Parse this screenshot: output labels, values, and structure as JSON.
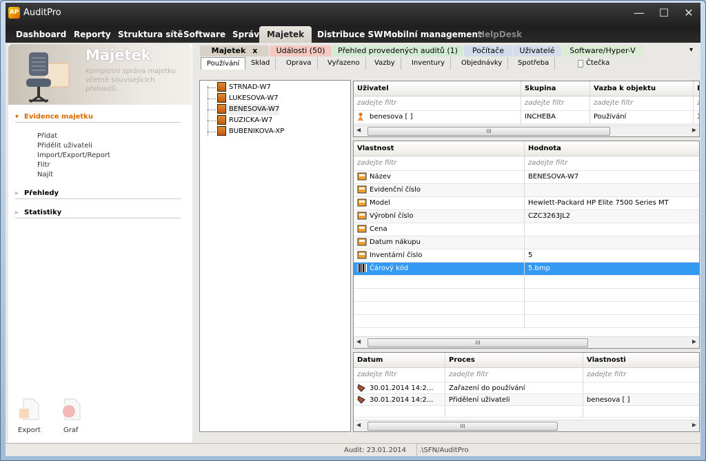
{
  "app": {
    "title": "AuditPro",
    "logo": "AP"
  },
  "window_controls": {
    "minimize": "—",
    "maximize": "☐",
    "close": "✕"
  },
  "main_tabs": [
    {
      "label": "Dashboard"
    },
    {
      "label": "Reporty"
    },
    {
      "label": "Struktura sítě"
    },
    {
      "label": "Software"
    },
    {
      "label": "Správa"
    },
    {
      "label": "Majetek",
      "active": true
    },
    {
      "label": "Distribuce SW"
    },
    {
      "label": "Mobilní management"
    },
    {
      "label": "HelpDesk",
      "disabled": true
    }
  ],
  "sidebar": {
    "title": "Majetek",
    "description": "Kompletní správa majetku včetně souvisejících přehledů.",
    "sections": [
      {
        "label": "Evidence majetku",
        "open": true,
        "items": [
          "Přidat",
          "Přidělit uživateli",
          "Import/Export/Report",
          "Filtr",
          "Najít"
        ]
      },
      {
        "label": "Přehledy"
      },
      {
        "label": "Statistiky"
      }
    ],
    "buttons": [
      {
        "label": "Export",
        "icon": "export-icon"
      },
      {
        "label": "Graf",
        "icon": "chart-icon"
      }
    ]
  },
  "content_tabs": [
    {
      "label": "Majetek",
      "color": "#d8d2c6",
      "closable": "x"
    },
    {
      "label": "Události (50)",
      "color": "#f4c9c0"
    },
    {
      "label": "Přehled provedených auditů (1)",
      "color": "#d3ead3"
    },
    {
      "label": "Počítače",
      "color": "#d2dcec"
    },
    {
      "label": "Uživatelé",
      "color": "#d6dcec"
    },
    {
      "label": "Software/Hyper-V",
      "color": "#dcecd4"
    }
  ],
  "tab_menu": "▾",
  "sub_tabs": [
    "Používání",
    "Sklad",
    "Oprava",
    "Vyřazeno",
    "Vazby",
    "Inventury",
    "Objednávky",
    "Spotřeba"
  ],
  "reader_checkbox": {
    "label": "Čtečka",
    "checked": false
  },
  "tree": {
    "items": [
      "STRNAD-W7",
      "LUKESOVA-W7",
      "BENESOVA-W7",
      "RUZICKA-W7",
      "BUBENIKOVA-XP"
    ],
    "selected": "BENESOVA-W7"
  },
  "users_grid": {
    "columns": [
      "Uživatel",
      "Skupina",
      "Vazba k objektu",
      "D"
    ],
    "filter": "zadejte filtr",
    "rows": [
      [
        "benesova [ ]",
        "INCHEBA",
        "Používání",
        "3"
      ]
    ]
  },
  "props_grid": {
    "columns": [
      "Vlastnost",
      "Hodnota"
    ],
    "filter": "zadejte filtr",
    "rows": [
      [
        "Název",
        "BENESOVA-W7"
      ],
      [
        "Evidenční číslo",
        ""
      ],
      [
        "Model",
        "Hewlett-Packard HP Elite 7500 Series MT"
      ],
      [
        "Výrobní číslo",
        "CZC3263JL2"
      ],
      [
        "Cena",
        ""
      ],
      [
        "Datum nákupu",
        ""
      ],
      [
        "Inventární číslo",
        "5"
      ],
      [
        "Čárový kód",
        "5.bmp"
      ]
    ],
    "selected": "Čárový kód",
    "accent": "#3399f3"
  },
  "history_grid": {
    "columns": [
      "Datum",
      "Proces",
      "Vlastnosti"
    ],
    "filter": "zadejte filtr",
    "rows": [
      [
        "30.01.2014 14:2...",
        "Zařazení do používání",
        ""
      ],
      [
        "30.01.2014 14:2...",
        "Přidělení uživateli",
        "benesova [ ]"
      ]
    ]
  },
  "scroll_thumb": "III",
  "status": {
    "audit": "Audit: 23.01.2014",
    "path": ".\\SFN/AuditPro"
  }
}
